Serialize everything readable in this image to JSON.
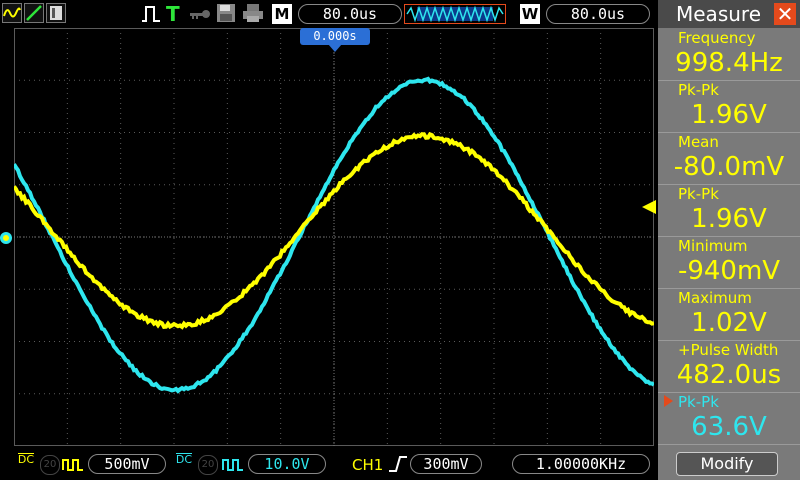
{
  "topbar": {
    "mode_label": "M",
    "timebase_value": "80.0us",
    "window_label": "W",
    "window_value": "80.0us",
    "trigger_letter": "T",
    "trigger_position": "0.000s"
  },
  "panel": {
    "title": "Measure",
    "close_glyph": "✕",
    "items": [
      {
        "label": "Frequency",
        "value": "998.4Hz",
        "color": "#ffff00"
      },
      {
        "label": "Pk-Pk",
        "value": "1.96V",
        "color": "#ffff00"
      },
      {
        "label": "Mean",
        "value": "-80.0mV",
        "color": "#ffff00"
      },
      {
        "label": "Pk-Pk",
        "value": "1.96V",
        "color": "#ffff00"
      },
      {
        "label": "Minimum",
        "value": "-940mV",
        "color": "#ffff00"
      },
      {
        "label": "Maximum",
        "value": "1.02V",
        "color": "#ffff00"
      },
      {
        "label": "+Pulse Width",
        "value": "482.0us",
        "color": "#ffff00"
      },
      {
        "label": "Pk-Pk",
        "value": "63.6V",
        "color": "#2ee6ee"
      }
    ],
    "modify_label": "Modify"
  },
  "bottombar": {
    "ch1_coupling": "DC",
    "ch1_badge": "20",
    "ch1_scale": "500mV",
    "ch2_coupling": "DC",
    "ch2_badge": "20",
    "ch2_scale": "10.0V",
    "trigger_source": "CH1",
    "trigger_level": "300mV",
    "frequency": "1.00000KHz"
  },
  "colors": {
    "ch1": "#ffff00",
    "ch2": "#2ee6ee",
    "accent": "#e44a1c",
    "trigger_marker": "#2b6fd6"
  },
  "icons": [
    "ch1-wave-icon",
    "ch2-wave-icon",
    "menu-icon",
    "pulse-icon",
    "trigger-icon",
    "key-icon",
    "save-icon",
    "print-icon"
  ]
}
